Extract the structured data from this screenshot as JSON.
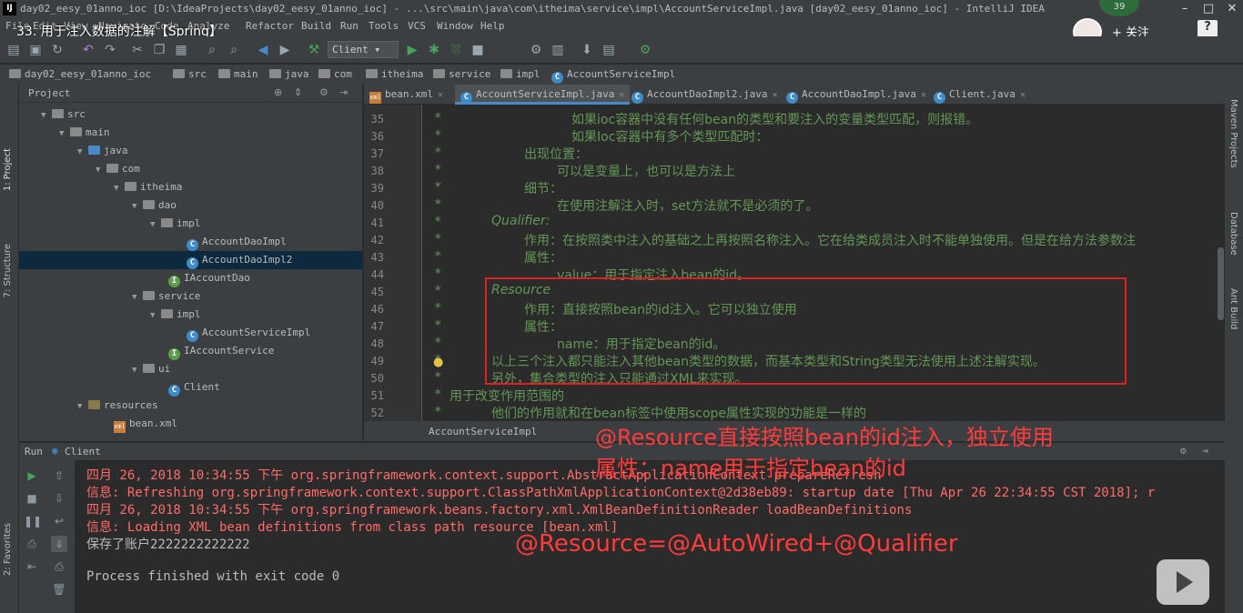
{
  "window": {
    "title": "day02_eesy_01anno_ioc [D:\\IdeaProjects\\day02_eesy_01anno_ioc] - ...\\src\\main\\java\\com\\itheima\\service\\impl\\AccountServiceImpl.java [day02_eesy_01anno_ioc] - IntelliJ IDEA",
    "badge": "39",
    "minimize": "–",
    "maximize": "□",
    "close": "✕"
  },
  "video": {
    "title": "33. 用于注入数据的注解【Spring】",
    "close": "✕",
    "follow": "+ 关注",
    "help": "?"
  },
  "menu": [
    "File",
    "Edit",
    "View",
    "Navigate",
    "Code",
    "Analyze",
    "Refactor",
    "Build",
    "Run",
    "Tools",
    "VCS",
    "Window",
    "Help"
  ],
  "toolbar": {
    "run_config": "Client ▾"
  },
  "breadcrumbs": [
    "day02_eesy_01anno_ioc",
    "src",
    "main",
    "java",
    "com",
    "itheima",
    "service",
    "impl",
    "AccountServiceImpl"
  ],
  "project_panel": {
    "title": "Project",
    "tree": [
      {
        "label": "src",
        "kind": "folder"
      },
      {
        "label": "main",
        "kind": "folder"
      },
      {
        "label": "java",
        "kind": "folder"
      },
      {
        "label": "com",
        "kind": "folder"
      },
      {
        "label": "itheima",
        "kind": "folder"
      },
      {
        "label": "dao",
        "kind": "folder"
      },
      {
        "label": "impl",
        "kind": "folder"
      },
      {
        "label": "AccountDaoImpl",
        "kind": "class"
      },
      {
        "label": "AccountDaoImpl2",
        "kind": "class",
        "selected": true
      },
      {
        "label": "IAccountDao",
        "kind": "interface"
      },
      {
        "label": "service",
        "kind": "folder"
      },
      {
        "label": "impl",
        "kind": "folder"
      },
      {
        "label": "AccountServiceImpl",
        "kind": "class"
      },
      {
        "label": "IAccountService",
        "kind": "interface"
      },
      {
        "label": "ui",
        "kind": "folder"
      },
      {
        "label": "Client",
        "kind": "class"
      },
      {
        "label": "resources",
        "kind": "folder"
      },
      {
        "label": "bean.xml",
        "kind": "xml"
      }
    ]
  },
  "tabs": [
    {
      "label": "bean.xml",
      "kind": "xml"
    },
    {
      "label": "AccountServiceImpl.java",
      "kind": "class",
      "active": true
    },
    {
      "label": "AccountDaoImpl2.java",
      "kind": "class"
    },
    {
      "label": "AccountDaoImpl.java",
      "kind": "class"
    },
    {
      "label": "Client.java",
      "kind": "class"
    }
  ],
  "editor": {
    "lines": [
      {
        "n": "35",
        "text": "如果ioc容器中没有任何bean的类型和要注入的变量类型匹配，则报错。"
      },
      {
        "n": "36",
        "text": "如果Ioc容器中有多个类型匹配时："
      },
      {
        "n": "37",
        "text": "出现位置："
      },
      {
        "n": "38",
        "text": "可以是变量上，也可以是方法上"
      },
      {
        "n": "39",
        "text": "细节："
      },
      {
        "n": "40",
        "text": "在使用注解注入时，set方法就不是必须的了。"
      },
      {
        "n": "41",
        "text": "Qualifier:"
      },
      {
        "n": "42",
        "text": "作用：在按照类中注入的基础之上再按照名称注入。它在给类成员注入时不能单独使用。但是在给方法参数注"
      },
      {
        "n": "43",
        "text": "属性："
      },
      {
        "n": "44",
        "text": "value：用于指定注入bean的id。"
      },
      {
        "n": "45",
        "text": "Resource"
      },
      {
        "n": "46",
        "text": "作用：直接按照bean的id注入。它可以独立使用"
      },
      {
        "n": "47",
        "text": "属性："
      },
      {
        "n": "48",
        "text": "name：用于指定bean的id。"
      },
      {
        "n": "49",
        "text": "以上三个注入都只能注入其他bean类型的数据，而基本类型和String类型无法使用上述注解实现。"
      },
      {
        "n": "50",
        "text": "另外，集合类型的注入只能通过XML来实现。"
      },
      {
        "n": "51",
        "text": "用于改变作用范围的"
      },
      {
        "n": "52",
        "text": "他们的作用就和在bean标签中使用scope属性实现的功能是一样的"
      }
    ],
    "star": "*",
    "footer": "AccountServiceImpl"
  },
  "left_stripe": [
    "1: Project",
    "7: Structure",
    "2: Favorites"
  ],
  "right_stripe": [
    "Maven Projects",
    "Database",
    "Ant Build"
  ],
  "run_panel": {
    "title": "Run",
    "config": "Client",
    "console": [
      {
        "text": "四月 26, 2018 10:34:55 下午 org.springframework.context.support.AbstractApplicationContext prepareRefresh",
        "kind": "err"
      },
      {
        "text": "信息: Refreshing org.springframework.context.support.ClassPathXmlApplicationContext@2d38eb89: startup date [Thu Apr 26 22:34:55 CST 2018]; r",
        "kind": "err"
      },
      {
        "text": "四月 26, 2018 10:34:55 下午 org.springframework.beans.factory.xml.XmlBeanDefinitionReader loadBeanDefinitions",
        "kind": "err"
      },
      {
        "text": "信息: Loading XML bean definitions from class path resource [bean.xml]",
        "kind": "err"
      },
      {
        "text": "保存了账户2222222222222",
        "kind": "out"
      },
      {
        "text": "",
        "kind": "out"
      },
      {
        "text": "Process finished with exit code 0",
        "kind": "out"
      }
    ]
  },
  "annotations": {
    "line1": "@Resource直接按照bean的id注入，独立使用",
    "line2": "属性：name用于指定bean的id",
    "line3": "@Resource=@AutoWired+@Qualifier",
    "color": "#ff3b3b"
  }
}
